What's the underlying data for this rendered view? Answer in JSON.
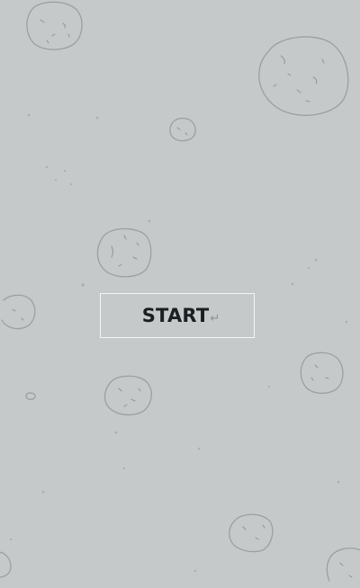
{
  "screen": "start-menu",
  "start_button": {
    "label": "START",
    "icon": "return-icon",
    "icon_glyph": "↵"
  },
  "colors": {
    "background": "#c5c9ca",
    "asteroid_outline": "#9aa0a1",
    "button_border": "#f3f5f5",
    "button_text": "#1c1f22"
  }
}
